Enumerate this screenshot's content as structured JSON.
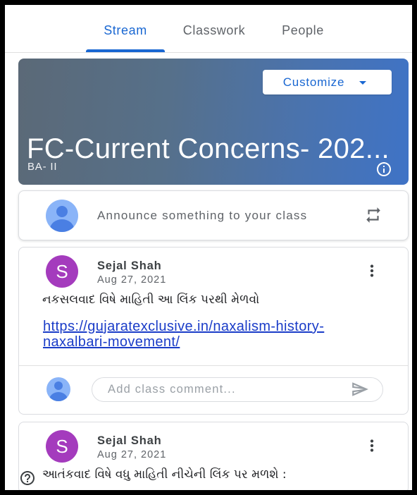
{
  "tabs": [
    {
      "label": "Stream",
      "active": true
    },
    {
      "label": "Classwork",
      "active": false
    },
    {
      "label": "People",
      "active": false
    }
  ],
  "banner": {
    "customize_label": "Customize",
    "title": "FC-Current Concerns- 202...",
    "section": "BA- II"
  },
  "announce": {
    "text": "Announce something to your class"
  },
  "posts": [
    {
      "author": "Sejal Shah",
      "avatar_letter": "S",
      "date": "Aug 27, 2021",
      "text": "નકસલવાદ વિષે માહિતી આ લિંક પરથી મેળવો",
      "link": "https://gujaratexclusive.in/naxalism-history-naxalbari-movement/",
      "comment_placeholder": "Add class comment..."
    },
    {
      "author": "Sejal Shah",
      "avatar_letter": "S",
      "date": "Aug 27, 2021",
      "text": "આતંકવાદ વિષે વધુ માહિતી નીચેની લિંક પર મળશે :"
    }
  ],
  "icons": {
    "customize_caret": "arrow-drop-down-icon",
    "class_info": "info-icon",
    "announce_avatar": "person-avatar-icon",
    "reuse_post": "repeat-icon",
    "post_menu": "more-vert-icon",
    "comment_avatar": "person-avatar-icon",
    "send_comment": "send-icon",
    "help": "help-icon"
  },
  "colors": {
    "accent": "#1967d2",
    "tab_inactive": "#5f6368",
    "banner_start": "#5b6977",
    "banner_end": "#3f73c6",
    "avatar_letter_bg": "#a43bbd",
    "avatar_person_bg": "#8ab4f8",
    "avatar_person_fg": "#4a7fe3",
    "link": "#1a3cc8",
    "text_primary": "#202124",
    "text_secondary": "#5f6368"
  }
}
